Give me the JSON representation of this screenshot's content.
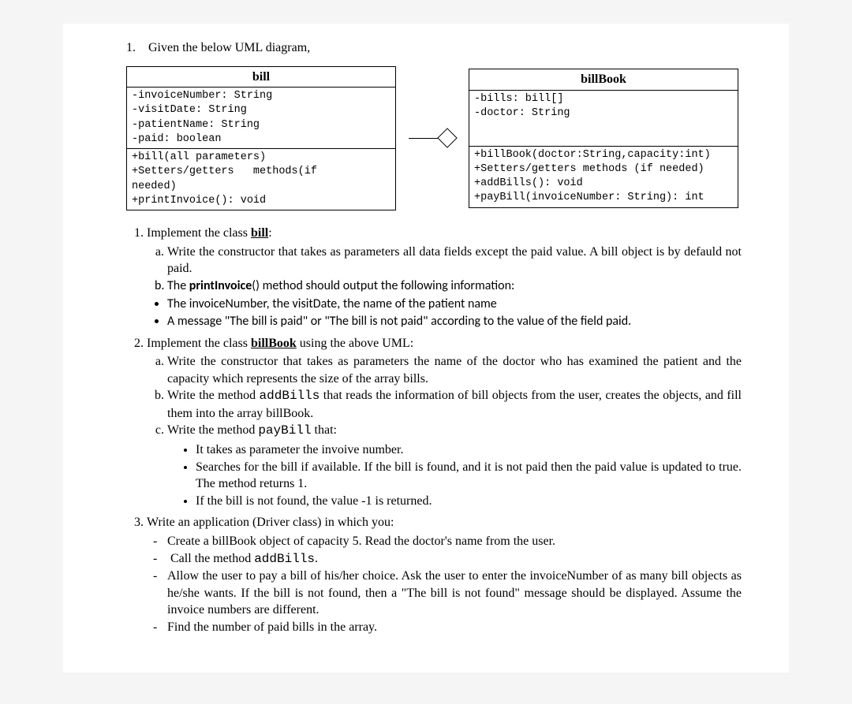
{
  "intro": {
    "num": "1.",
    "text": "Given the below UML diagram,"
  },
  "uml": {
    "bill": {
      "title": "bill",
      "attrs": [
        "-invoiceNumber: String",
        "-visitDate: String",
        "-patientName: String",
        "-paid: boolean"
      ],
      "methods": [
        "+bill(all parameters)",
        "+Setters/getters   methods(if",
        "needed)",
        "+printInvoice(): void"
      ]
    },
    "billBook": {
      "title": "billBook",
      "attrs": [
        "-bills: bill[]",
        "-doctor: String"
      ],
      "methods": [
        "+billBook(doctor:String,capacity:int)",
        "+Setters/getters methods (if needed)",
        "+addBills(): void",
        "+payBill(invoiceNumber: String): int"
      ]
    }
  },
  "tasks": {
    "t1": {
      "lead": "Implement the class ",
      "class": "bill",
      "tail": ":",
      "a": "Write the constructor that takes as parameters all data fields except the paid value. A bill object is by defauld not paid.",
      "b_lead": "The ",
      "b_bold": "printInvoice",
      "b_tail": "() method should output the following information:",
      "b_b1": "The invoiceNumber, the visitDate, the name of the patient name",
      "b_b2": "A message \"The bill is paid\" or \"The bill is not paid\" according to the value of the field paid."
    },
    "t2": {
      "lead": "Implement the class ",
      "class": "billBook",
      "tail": " using the above UML:",
      "a": "Write the constructor that takes as parameters the name of the doctor who has examined the patient and the capacity which represents the size of the array bills.",
      "b_lead": "Write the method ",
      "b_code": "addBills",
      "b_tail": " that reads the information of bill objects from the user, creates the objects, and fill them into the array billBook.",
      "c_lead": "Write the method ",
      "c_code": "payBill",
      "c_tail": "  that:",
      "c_b1": "It takes as parameter the invoive number.",
      "c_b2": "Searches for the bill if available. If the bill is found, and it is not paid then the paid value is updated to true. The method returns 1.",
      "c_b3": "If the bill is not found,  the value -1 is returned."
    },
    "t3": {
      "lead": "Write an application (Driver class) in which you:",
      "d1": "Create a billBook object of capacity 5. Read the doctor's name from the user.",
      "d2_lead": "Call the method ",
      "d2_code": "addBills",
      "d2_tail": ".",
      "d3": "Allow the user to pay a bill of his/her choice. Ask the user to enter the invoiceNumber of as many bill objects as he/she wants. If the bill is not found, then a \"The bill is not found\" message should be displayed. Assume the invoice numbers are different.",
      "d4": "Find the number of paid bills in the array."
    }
  }
}
